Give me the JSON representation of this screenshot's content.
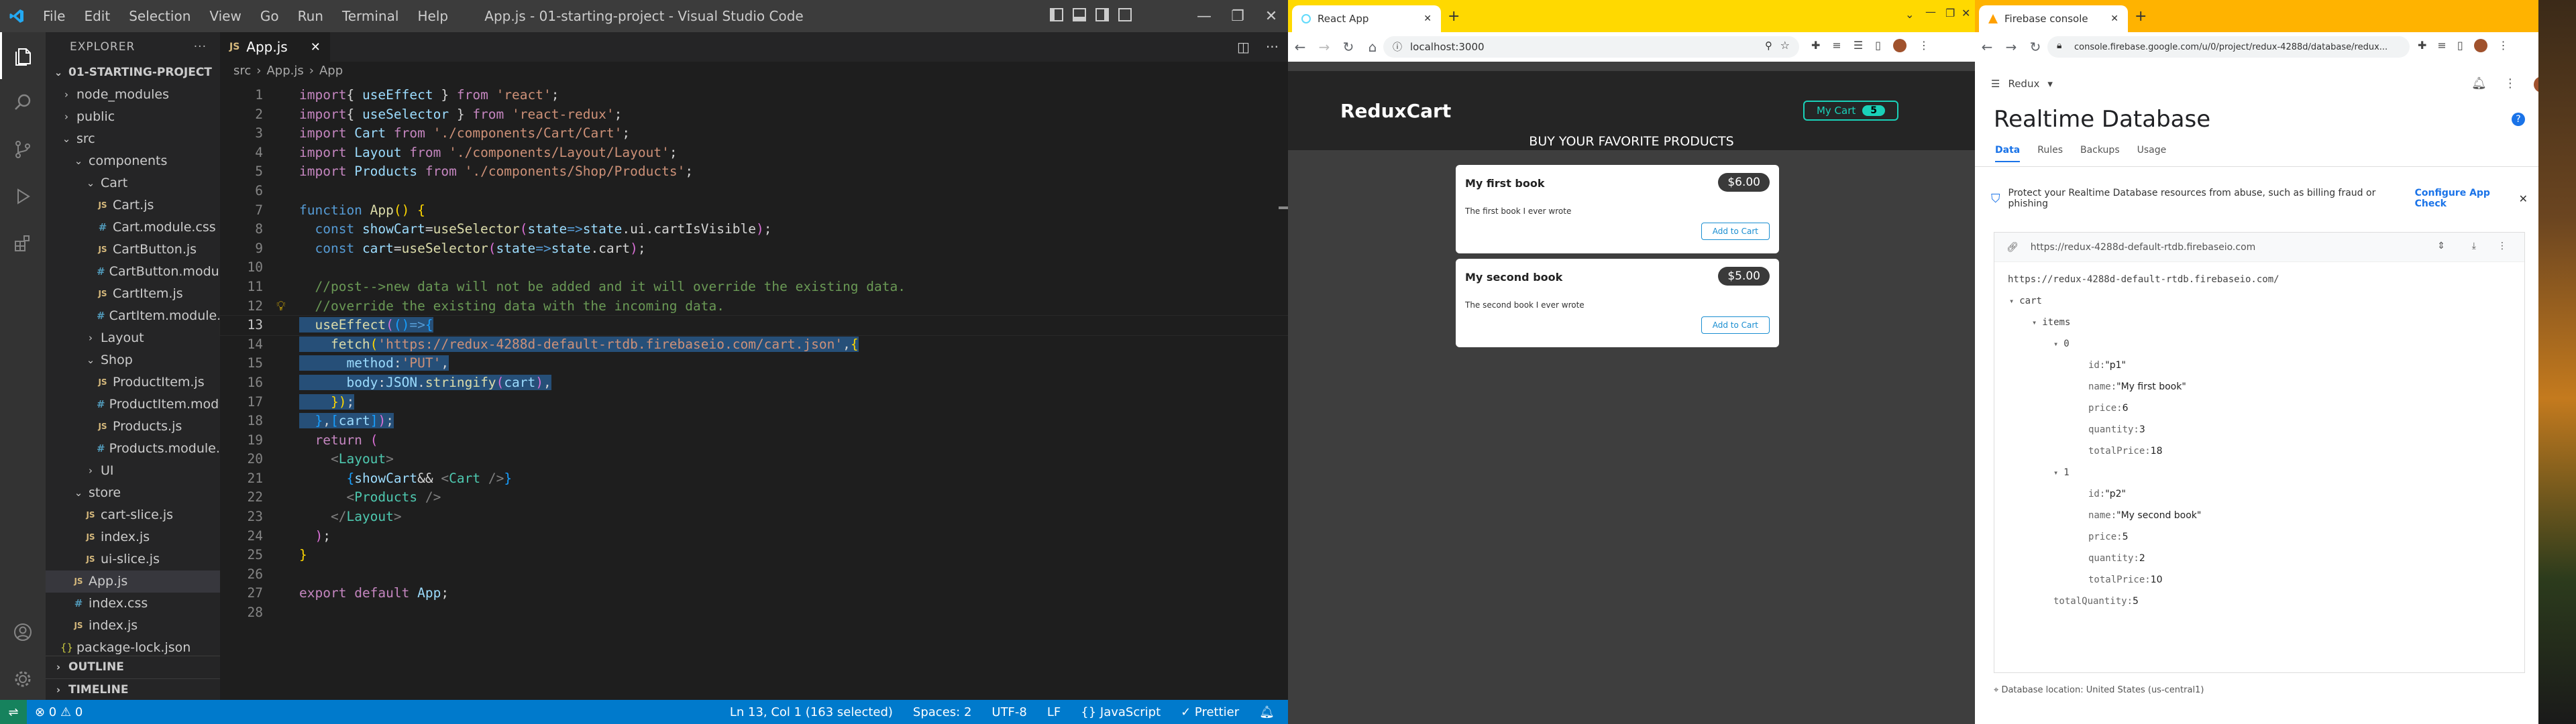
{
  "vscode": {
    "menus": [
      "File",
      "Edit",
      "Selection",
      "View",
      "Go",
      "Run",
      "Terminal",
      "Help"
    ],
    "window_title": "App.js - 01-starting-project - Visual Studio Code",
    "explorer_title": "EXPLORER",
    "project": "01-STARTING-PROJECT",
    "tree": [
      {
        "label": "node_modules",
        "type": "folder-closed",
        "depth": 0
      },
      {
        "label": "public",
        "type": "folder-closed",
        "depth": 0
      },
      {
        "label": "src",
        "type": "folder-open",
        "depth": 0
      },
      {
        "label": "components",
        "type": "folder-open",
        "depth": 1
      },
      {
        "label": "Cart",
        "type": "folder-open",
        "depth": 2
      },
      {
        "label": "Cart.js",
        "type": "js",
        "depth": 3
      },
      {
        "label": "Cart.module.css",
        "type": "css",
        "depth": 3
      },
      {
        "label": "CartButton.js",
        "type": "js",
        "depth": 3
      },
      {
        "label": "CartButton.modu...",
        "type": "css",
        "depth": 3
      },
      {
        "label": "CartItem.js",
        "type": "js",
        "depth": 3
      },
      {
        "label": "CartItem.module....",
        "type": "css",
        "depth": 3
      },
      {
        "label": "Layout",
        "type": "folder-closed",
        "depth": 2
      },
      {
        "label": "Shop",
        "type": "folder-open",
        "depth": 2
      },
      {
        "label": "ProductItem.js",
        "type": "js",
        "depth": 3
      },
      {
        "label": "ProductItem.mod...",
        "type": "css",
        "depth": 3
      },
      {
        "label": "Products.js",
        "type": "js",
        "depth": 3
      },
      {
        "label": "Products.module....",
        "type": "css",
        "depth": 3
      },
      {
        "label": "UI",
        "type": "folder-closed",
        "depth": 2
      },
      {
        "label": "store",
        "type": "folder-open",
        "depth": 1
      },
      {
        "label": "cart-slice.js",
        "type": "js",
        "depth": 2
      },
      {
        "label": "index.js",
        "type": "js",
        "depth": 2
      },
      {
        "label": "ui-slice.js",
        "type": "js",
        "depth": 2
      },
      {
        "label": "App.js",
        "type": "js",
        "depth": 1,
        "selected": true
      },
      {
        "label": "index.css",
        "type": "css",
        "depth": 1
      },
      {
        "label": "index.js",
        "type": "js",
        "depth": 1
      },
      {
        "label": "package-lock.json",
        "type": "json",
        "depth": 0
      }
    ],
    "outline_label": "OUTLINE",
    "timeline_label": "TIMELINE",
    "tab_label": "App.js",
    "breadcrumb": [
      "src",
      "App.js",
      "App"
    ],
    "code": [
      [
        [
          "k",
          "import"
        ],
        [
          "",
          "{ "
        ],
        [
          "v",
          "useEffect"
        ],
        [
          "",
          " } "
        ],
        [
          "k",
          "from"
        ],
        [
          "",
          " "
        ],
        [
          "s",
          "'react'"
        ],
        [
          "",
          ";"
        ]
      ],
      [
        [
          "k",
          "import"
        ],
        [
          "",
          "{ "
        ],
        [
          "v",
          "useSelector"
        ],
        [
          "",
          " } "
        ],
        [
          "k",
          "from"
        ],
        [
          "",
          " "
        ],
        [
          "s",
          "'react-redux'"
        ],
        [
          "",
          ";"
        ]
      ],
      [
        [
          "k",
          "import"
        ],
        [
          "",
          " "
        ],
        [
          "v",
          "Cart"
        ],
        [
          "",
          " "
        ],
        [
          "k",
          "from"
        ],
        [
          "",
          " "
        ],
        [
          "s",
          "'./components/Cart/Cart'"
        ],
        [
          "",
          ";"
        ]
      ],
      [
        [
          "k",
          "import"
        ],
        [
          "",
          " "
        ],
        [
          "v",
          "Layout"
        ],
        [
          "",
          " "
        ],
        [
          "k",
          "from"
        ],
        [
          "",
          " "
        ],
        [
          "s",
          "'./components/Layout/Layout'"
        ],
        [
          "",
          ";"
        ]
      ],
      [
        [
          "k",
          "import"
        ],
        [
          "",
          " "
        ],
        [
          "v",
          "Products"
        ],
        [
          "",
          " "
        ],
        [
          "k",
          "from"
        ],
        [
          "",
          " "
        ],
        [
          "s",
          "'./components/Shop/Products'"
        ],
        [
          "",
          ";"
        ]
      ],
      [],
      [
        [
          "b",
          "function"
        ],
        [
          "",
          " "
        ],
        [
          "f",
          "App"
        ],
        [
          "y",
          "()"
        ],
        [
          "",
          " "
        ],
        [
          "y",
          "{"
        ]
      ],
      [
        [
          "",
          "  "
        ],
        [
          "b",
          "const"
        ],
        [
          "",
          " "
        ],
        [
          "v",
          "showCart"
        ],
        [
          "",
          "="
        ],
        [
          "f",
          "useSelector"
        ],
        [
          "pk",
          "("
        ],
        [
          "v",
          "state"
        ],
        [
          "b",
          "=>"
        ],
        [
          "v",
          "state"
        ],
        [
          "",
          ".ui.cartIsVisible"
        ],
        [
          "pk",
          ")"
        ],
        [
          "",
          ";"
        ]
      ],
      [
        [
          "",
          "  "
        ],
        [
          "b",
          "const"
        ],
        [
          "",
          " "
        ],
        [
          "v",
          "cart"
        ],
        [
          "",
          "="
        ],
        [
          "f",
          "useSelector"
        ],
        [
          "pk",
          "("
        ],
        [
          "v",
          "state"
        ],
        [
          "b",
          "=>"
        ],
        [
          "v",
          "state"
        ],
        [
          "",
          ".cart"
        ],
        [
          "pk",
          ")"
        ],
        [
          "",
          ";"
        ]
      ],
      [],
      [
        [
          "",
          "  "
        ],
        [
          "c",
          "//post-->new data will not be added and it will override the existing data."
        ]
      ],
      [
        [
          "",
          "  "
        ],
        [
          "c",
          "//override the existing data with the incoming data."
        ]
      ],
      [
        [
          "",
          "  "
        ],
        [
          "f",
          "useEffect"
        ],
        [
          "pk",
          "("
        ],
        [
          "bl",
          "()"
        ],
        [
          "b",
          "=>"
        ],
        [
          "bl",
          "{"
        ]
      ],
      [
        [
          "",
          "    "
        ],
        [
          "f",
          "fetch"
        ],
        [
          "y",
          "("
        ],
        [
          "s",
          "'https://redux-4288d-default-rtdb.firebaseio.com/cart.json'"
        ],
        [
          "",
          ","
        ],
        [
          "y",
          "{"
        ]
      ],
      [
        [
          "",
          "      "
        ],
        [
          "v",
          "method"
        ],
        [
          "",
          ":"
        ],
        [
          "s",
          "'PUT'"
        ],
        [
          "",
          ","
        ]
      ],
      [
        [
          "",
          "      "
        ],
        [
          "v",
          "body"
        ],
        [
          "",
          ":"
        ],
        [
          "v",
          "JSON"
        ],
        [
          "",
          "."
        ],
        [
          "f",
          "stringify"
        ],
        [
          "pk",
          "("
        ],
        [
          "v",
          "cart"
        ],
        [
          "pk",
          ")"
        ],
        [
          "",
          ","
        ]
      ],
      [
        [
          "",
          "    "
        ],
        [
          "y",
          "}"
        ],
        [
          "y",
          ")"
        ],
        [
          "",
          ";"
        ]
      ],
      [
        [
          "",
          "  "
        ],
        [
          "bl",
          "}"
        ],
        [
          "",
          ","
        ],
        [
          "bl",
          "["
        ],
        [
          "v",
          "cart"
        ],
        [
          "bl",
          "]"
        ],
        [
          "pk",
          ")"
        ],
        [
          "",
          ";"
        ]
      ],
      [
        [
          "",
          "  "
        ],
        [
          "k",
          "return"
        ],
        [
          "",
          " "
        ],
        [
          "pk",
          "("
        ]
      ],
      [
        [
          "",
          "    "
        ],
        [
          "p",
          "<"
        ],
        [
          "t",
          "Layout"
        ],
        [
          "p",
          ">"
        ]
      ],
      [
        [
          "",
          "      "
        ],
        [
          "bl",
          "{"
        ],
        [
          "v",
          "showCart"
        ],
        [
          "",
          "&& "
        ],
        [
          "p",
          "<"
        ],
        [
          "t",
          "Cart"
        ],
        [
          "",
          " "
        ],
        [
          "p",
          "/>"
        ],
        [
          "bl",
          "}"
        ]
      ],
      [
        [
          "",
          "      "
        ],
        [
          "p",
          "<"
        ],
        [
          "t",
          "Products"
        ],
        [
          "",
          " "
        ],
        [
          "p",
          "/>"
        ]
      ],
      [
        [
          "",
          "    "
        ],
        [
          "p",
          "</"
        ],
        [
          "t",
          "Layout"
        ],
        [
          "p",
          ">"
        ]
      ],
      [
        [
          "",
          "  "
        ],
        [
          "pk",
          ")"
        ],
        [
          "",
          ";"
        ]
      ],
      [
        [
          "y",
          "}"
        ]
      ],
      [],
      [
        [
          "k",
          "export"
        ],
        [
          "",
          " "
        ],
        [
          "k",
          "default"
        ],
        [
          "",
          " "
        ],
        [
          "v",
          "App"
        ],
        [
          "",
          ";"
        ]
      ],
      []
    ],
    "selected_lines": [
      13,
      14,
      15,
      16,
      17,
      18
    ],
    "current_line": 13,
    "status_left": "⊗ 0 ⚠ 0",
    "status_items": [
      "Ln 13, Col 1 (163 selected)",
      "Spaces: 2",
      "UTF-8",
      "LF",
      "{} JavaScript",
      "✓ Prettier"
    ]
  },
  "browser1": {
    "tab_title": "React App",
    "url": "localhost:3000",
    "brand": "ReduxCart",
    "cart_button_label": "My Cart",
    "cart_badge": "5",
    "heading": "BUY YOUR FAVORITE PRODUCTS",
    "products": [
      {
        "title": "My first book",
        "price": "$6.00",
        "description": "The first book I ever wrote",
        "button": "Add to Cart"
      },
      {
        "title": "My second book",
        "price": "$5.00",
        "description": "The second book I ever wrote",
        "button": "Add to Cart"
      }
    ]
  },
  "browser2": {
    "tab_title": "Firebase console",
    "url": "console.firebase.google.com/u/0/project/redux-4288d/database/redux...",
    "project_selector": "Redux",
    "page_title": "Realtime Database",
    "tabs": [
      "Data",
      "Rules",
      "Backups",
      "Usage"
    ],
    "banner_text": "Protect your Realtime Database resources from abuse, such as billing fraud or phishing",
    "banner_link": "Configure App Check",
    "db_url_bar": "https://redux-4288d-default-rtdb.firebaseio.com",
    "db_root": "https://redux-4288d-default-rtdb.firebaseio.com/",
    "tree": {
      "cart": "cart",
      "items": "items",
      "item0": {
        "index": "0",
        "id": "\"p1\"",
        "name": "\"My first book\"",
        "price": "6",
        "quantity": "3",
        "totalPrice": "18"
      },
      "item1": {
        "index": "1",
        "id": "\"p2\"",
        "name": "\"My second book\"",
        "price": "5",
        "quantity": "2",
        "totalPrice": "10"
      },
      "totalQuantity": "5"
    },
    "footer": "Database location: United States (us-central1)"
  },
  "colors": {
    "vscode_status": "#007acc",
    "chrome1_frame": "#ffd900",
    "chrome2_frame": "#ffb300",
    "firebase_blue": "#1a73e8",
    "badge_green": "#1ad1b9"
  }
}
